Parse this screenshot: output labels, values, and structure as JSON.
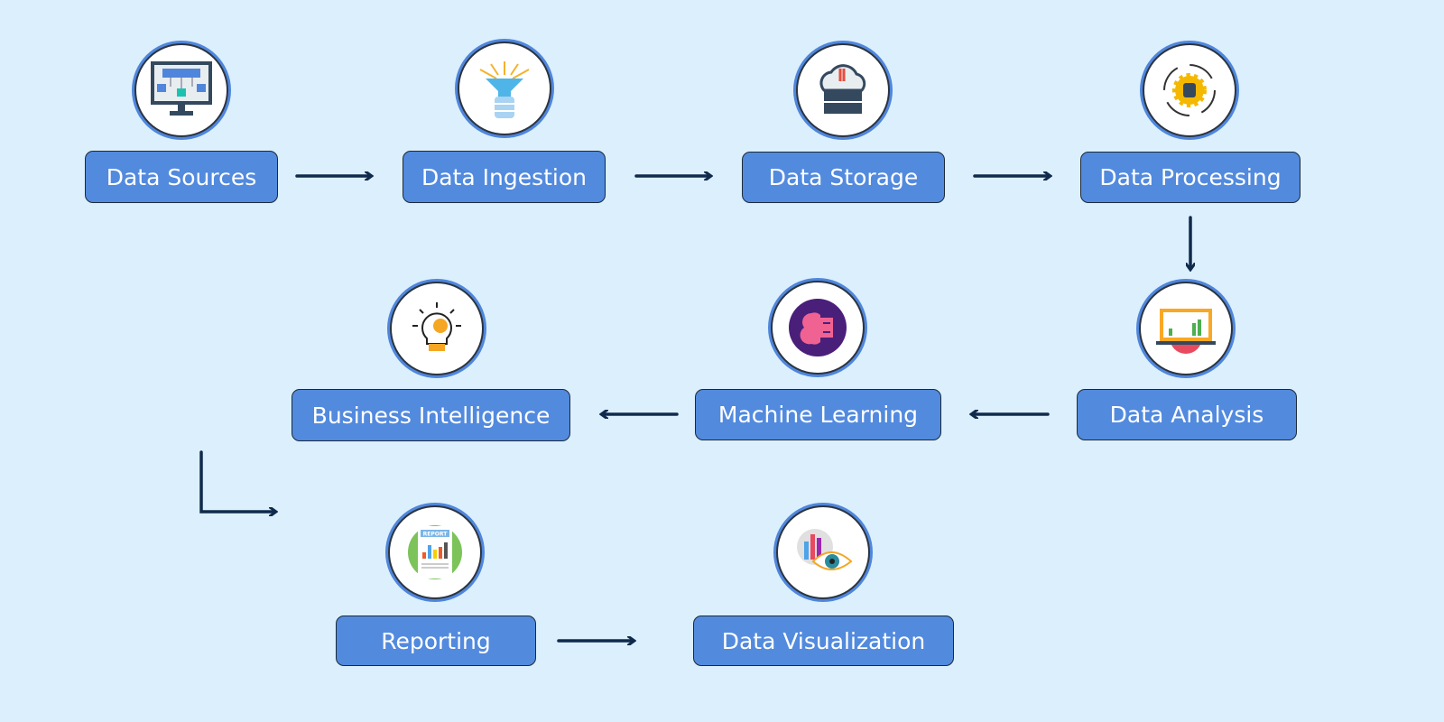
{
  "diagram": {
    "nodes": [
      {
        "label": "Data Sources",
        "icon": "monitor-network-icon"
      },
      {
        "label": "Data Ingestion",
        "icon": "funnel-database-icon"
      },
      {
        "label": "Data Storage",
        "icon": "cloud-server-icon"
      },
      {
        "label": "Data Processing",
        "icon": "gear-database-cycle-icon"
      },
      {
        "label": "Data Analysis",
        "icon": "laptop-chart-icon"
      },
      {
        "label": "Machine Learning",
        "icon": "brain-chip-icon"
      },
      {
        "label": "Business Intelligence",
        "icon": "lightbulb-gear-icon"
      },
      {
        "label": "Reporting",
        "icon": "report-chart-icon",
        "icon_text": "REPORT"
      },
      {
        "label": "Data Visualization",
        "icon": "chart-eye-icon"
      }
    ],
    "edges": [
      [
        "Data Sources",
        "Data Ingestion"
      ],
      [
        "Data Ingestion",
        "Data Storage"
      ],
      [
        "Data Storage",
        "Data Processing"
      ],
      [
        "Data Processing",
        "Data Analysis"
      ],
      [
        "Data Analysis",
        "Machine Learning"
      ],
      [
        "Machine Learning",
        "Business Intelligence"
      ],
      [
        "Business Intelligence",
        "Reporting"
      ],
      [
        "Reporting",
        "Data Visualization"
      ]
    ],
    "colors": {
      "background": "#dbeffd",
      "box": "#528ade",
      "arrow": "#102a4c"
    }
  }
}
